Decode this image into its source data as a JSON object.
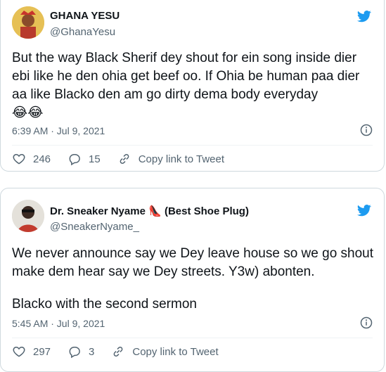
{
  "tweets": [
    {
      "display_name": "GHANA YESU",
      "handle": "@GhanaYesu",
      "text_lines": [
        "But the way Black Sherif dey shout for ein song inside dier ebi like he den ohia get beef oo. If Ohia be human paa dier aa like Blacko den am go dirty dema body everyday"
      ],
      "emoji": "😂😂",
      "timestamp": "6:39 AM · Jul 9, 2021",
      "likes": "246",
      "replies": "15",
      "copy_link_label": "Copy link to Tweet"
    },
    {
      "display_name": "Dr. Sneaker Nyame",
      "name_emoji": "👠",
      "display_name_suffix": "(Best Shoe Plug)",
      "handle": "@SneakerNyame_",
      "text_lines": [
        "We never announce say we Dey leave house so we go shout make dem hear say we Dey streets. Y3w) abonten.",
        "Blacko with the second sermon"
      ],
      "timestamp": "5:45 AM · Jul 9, 2021",
      "likes": "297",
      "replies": "3",
      "copy_link_label": "Copy link to Tweet"
    }
  ],
  "icons": [
    "twitter-bird-icon",
    "info-icon",
    "heart-icon",
    "reply-icon",
    "link-icon"
  ],
  "colors": {
    "twitter_blue": "#1d9bf0",
    "secondary_text": "#536471",
    "border": "#cfd9de"
  }
}
